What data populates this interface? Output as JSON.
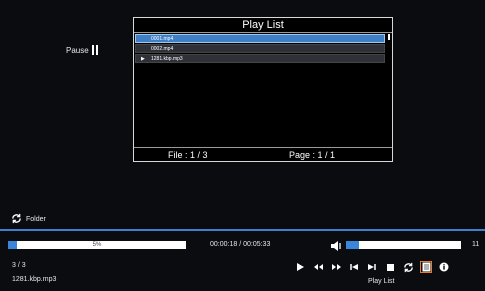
{
  "status": {
    "pause_label": "Pause"
  },
  "playlist": {
    "title": "Play List",
    "items": [
      {
        "name": "0001.mp4",
        "selected": true,
        "playing": false
      },
      {
        "name": "0002.mp4",
        "selected": false,
        "playing": false
      },
      {
        "name": "1281.kbp.mp3",
        "selected": false,
        "playing": true
      }
    ],
    "file_info": "File : 1 / 3",
    "page_info": "Page : 1 / 1"
  },
  "folder": {
    "label": "Folder"
  },
  "playback": {
    "progress_percent": 5,
    "progress_label": "5%",
    "time": "00:00:18 / 00:05:33",
    "volume_level": 11,
    "volume_max": 100,
    "volume_label": "11",
    "track_count": "3 / 3",
    "file_name": "1281.kbp.mp3"
  },
  "controls": {
    "items": [
      "play-icon",
      "rewind-icon",
      "fast-forward-icon",
      "previous-icon",
      "next-icon",
      "stop-icon",
      "repeat-icon",
      "playlist-icon",
      "info-icon"
    ],
    "active_label": "Play List"
  },
  "colors": {
    "accent": "#3a86d8",
    "selected_row": "#3f7fc6",
    "focus": "#e87a2a"
  }
}
